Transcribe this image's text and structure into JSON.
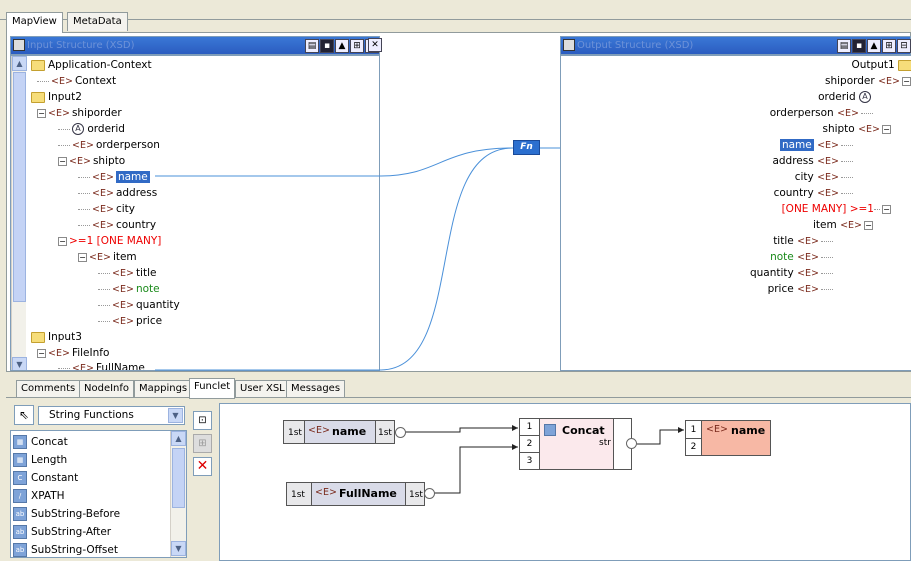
{
  "top_tabs": [
    "MapView",
    "MetaData"
  ],
  "left_panel": {
    "tree": [
      {
        "kind": "folder",
        "label": "Application-Context"
      },
      {
        "kind": "element",
        "label": "Context"
      },
      {
        "kind": "folder",
        "label": "Input2"
      },
      {
        "kind": "element",
        "label": "shiporder"
      },
      {
        "kind": "attribute",
        "label": "orderid"
      },
      {
        "kind": "element",
        "label": "orderperson"
      },
      {
        "kind": "element",
        "label": "shipto"
      },
      {
        "kind": "element",
        "label": "name"
      },
      {
        "kind": "element",
        "label": "address"
      },
      {
        "kind": "element",
        "label": "city"
      },
      {
        "kind": "element",
        "label": "country"
      },
      {
        "kind": "cardinality",
        "label": ">=1 [ONE MANY]"
      },
      {
        "kind": "element",
        "label": "item"
      },
      {
        "kind": "element",
        "label": "title"
      },
      {
        "kind": "element",
        "label": "note"
      },
      {
        "kind": "element",
        "label": "quantity"
      },
      {
        "kind": "element",
        "label": "price"
      },
      {
        "kind": "folder",
        "label": "Input3"
      },
      {
        "kind": "element",
        "label": "FileInfo"
      },
      {
        "kind": "element",
        "label": "FullName"
      }
    ]
  },
  "right_panel": {
    "tree": [
      {
        "kind": "folder",
        "label": "Output1"
      },
      {
        "kind": "element",
        "label": "shiporder"
      },
      {
        "kind": "attribute",
        "label": "orderid"
      },
      {
        "kind": "element",
        "label": "orderperson"
      },
      {
        "kind": "element",
        "label": "shipto"
      },
      {
        "kind": "element",
        "label": "name"
      },
      {
        "kind": "element",
        "label": "address"
      },
      {
        "kind": "element",
        "label": "city"
      },
      {
        "kind": "element",
        "label": "country"
      },
      {
        "kind": "cardinality",
        "label": "[ONE MANY] >=1"
      },
      {
        "kind": "element",
        "label": "item"
      },
      {
        "kind": "element",
        "label": "title"
      },
      {
        "kind": "element",
        "label": "note"
      },
      {
        "kind": "element",
        "label": "quantity"
      },
      {
        "kind": "element",
        "label": "price"
      }
    ]
  },
  "middle": {
    "function_badge": "Fn"
  },
  "bottom_tabs": [
    "Comments",
    "NodeInfo",
    "Mappings",
    "Funclet",
    "User XSL",
    "Messages"
  ],
  "function_category": "String Functions",
  "functions": [
    "Concat",
    "Length",
    "Constant",
    "XPATH",
    "SubString-Before",
    "SubString-After",
    "SubString-Offset"
  ],
  "funclet": {
    "node_name": {
      "label": "name",
      "in_port": "1st",
      "out_port": "1st"
    },
    "node_fullname": {
      "label": "FullName",
      "in_port": "1st",
      "out_port": "1st"
    },
    "concat": {
      "label": "Concat",
      "ports": [
        "1",
        "2",
        "3"
      ],
      "out": "str"
    },
    "target": {
      "label": "name",
      "ports": [
        "1",
        "2"
      ]
    }
  },
  "colors": {
    "selection": "#316ac5",
    "error": "#e00000",
    "link": "#4a90d9",
    "title_bar": "#2b5cc0"
  }
}
